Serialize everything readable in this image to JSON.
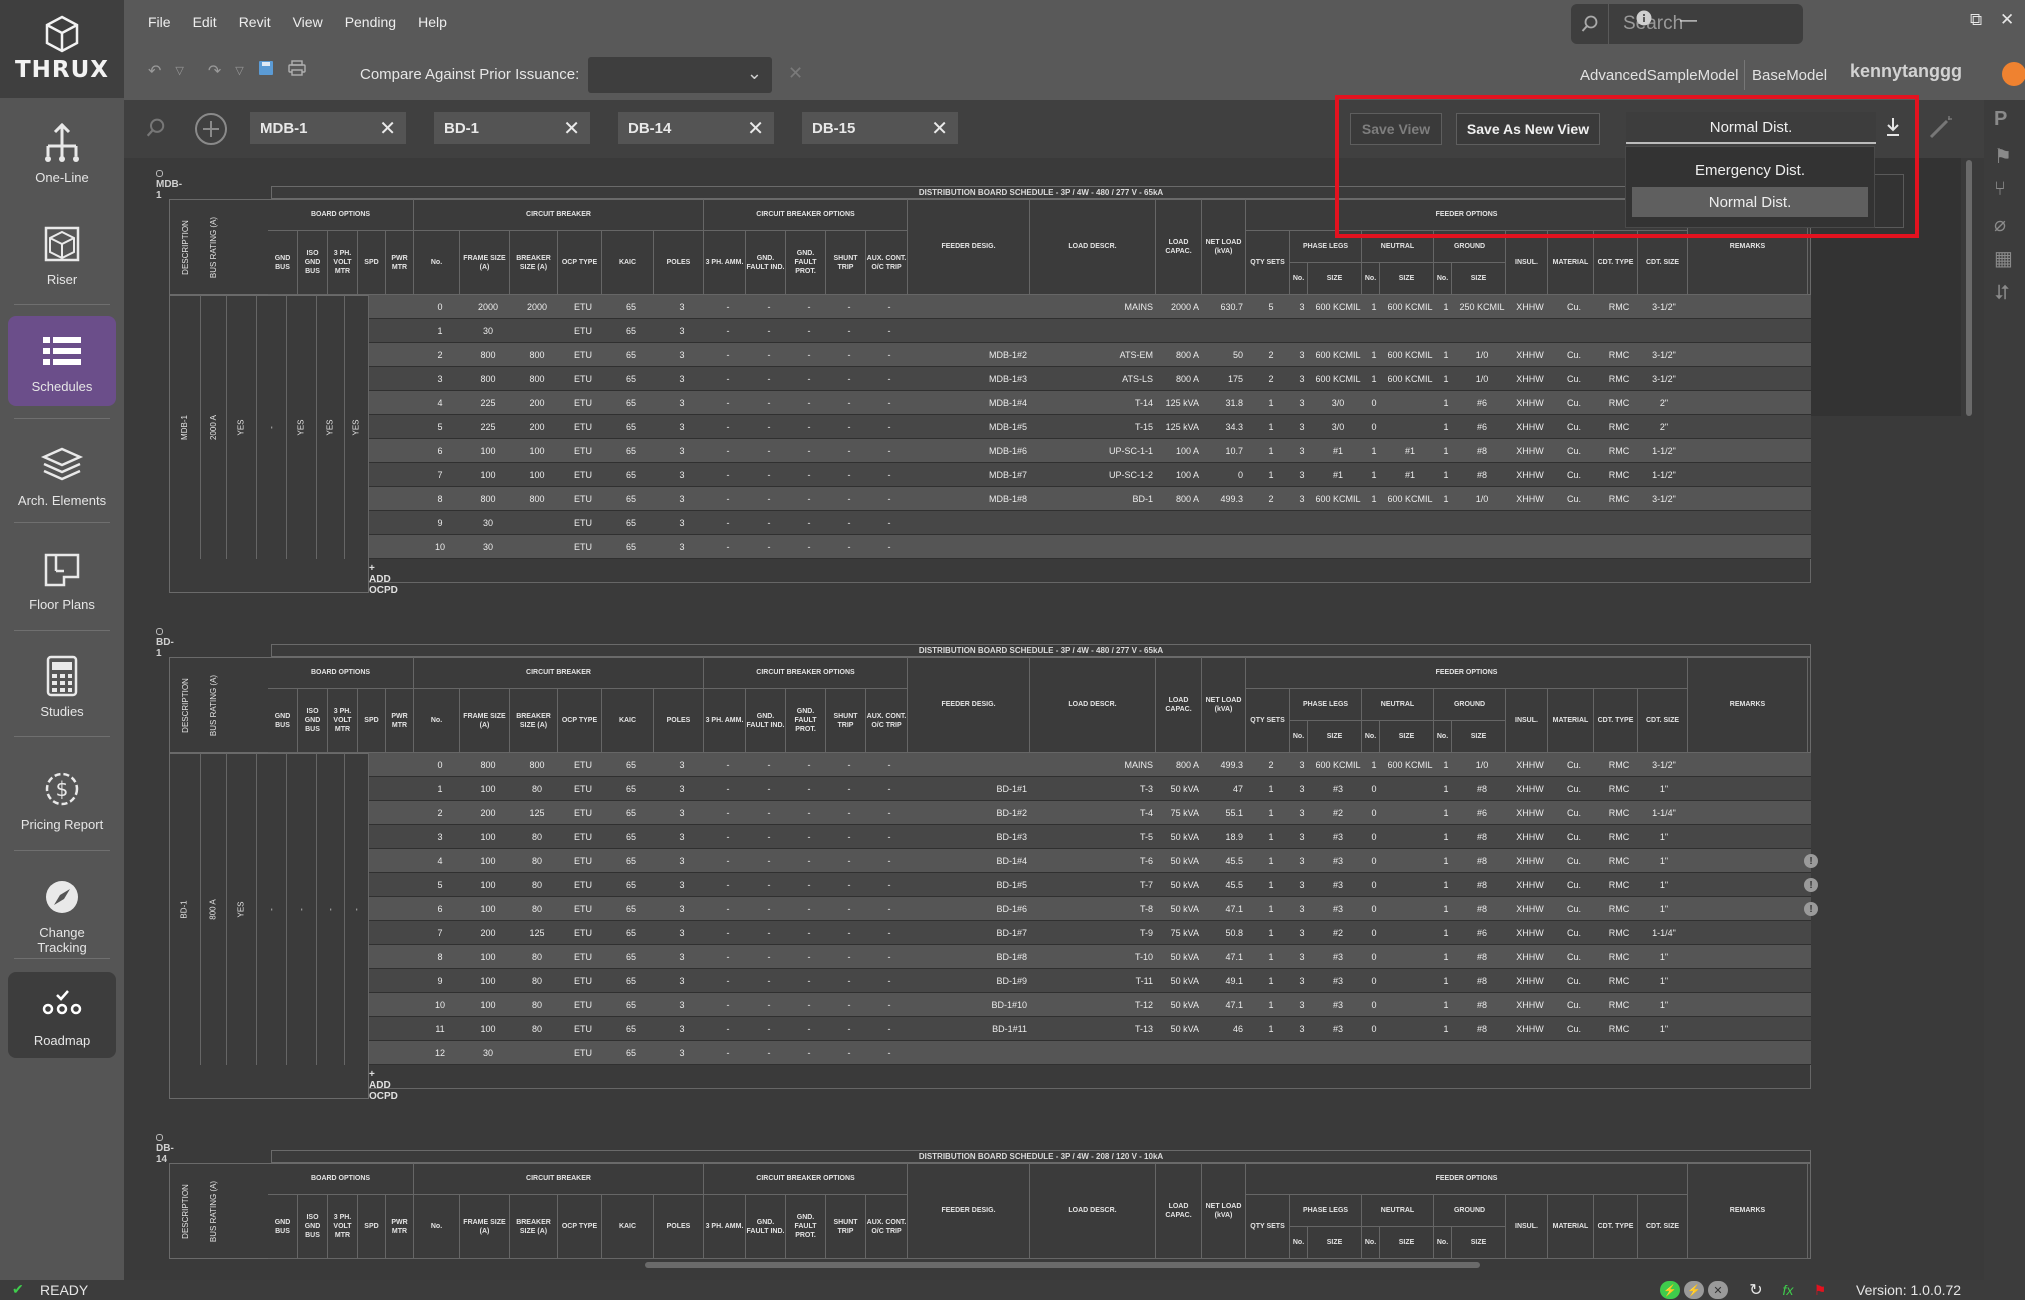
{
  "brand": {
    "name": "THRUX"
  },
  "nav": [
    {
      "label": "One-Line",
      "icon": "one-line-icon"
    },
    {
      "label": "Riser",
      "icon": "riser-cube-icon"
    },
    {
      "label": "Schedules",
      "icon": "schedules-list-icon"
    },
    {
      "label": "Arch. Elements",
      "icon": "layers-icon"
    },
    {
      "label": "Floor Plans",
      "icon": "floor-plan-icon"
    },
    {
      "label": "Studies",
      "icon": "calculator-icon"
    },
    {
      "label": "Pricing Report",
      "icon": "dollar-gear-icon"
    },
    {
      "label": "Change Tracking",
      "icon": "compass-icon"
    },
    {
      "label": "Roadmap",
      "icon": "roadmap-icon"
    }
  ],
  "menu": [
    "File",
    "Edit",
    "Revit",
    "View",
    "Pending",
    "Help"
  ],
  "search": {
    "placeholder": "Search"
  },
  "compare": {
    "label": "Compare Against Prior Issuance:",
    "value": ""
  },
  "models": {
    "a": "AdvancedSampleModel",
    "b": "BaseModel"
  },
  "user": {
    "name": "kennytanggg"
  },
  "tabs": [
    "MDB-1",
    "BD-1",
    "DB-14",
    "DB-15"
  ],
  "view_actions": {
    "save": "Save View",
    "save_as": "Save As New View"
  },
  "view_dropdown": {
    "selected": "Normal Dist.",
    "options": [
      "Emergency Dist.",
      "Normal Dist."
    ]
  },
  "headers": {
    "description": "DESCRIPTION",
    "bus_rating": "BUS RATING (A)",
    "board_options": "BOARD OPTIONS",
    "gnd_bus": "GND BUS",
    "iso_gnd_bus": "ISO GND BUS",
    "volt_mtr": "3 PH. VOLT MTR",
    "spd": "SPD",
    "pwr_mtr": "PWR MTR",
    "circuit_breaker": "CIRCUIT BREAKER",
    "no": "No.",
    "frame": "FRAME SIZE (A)",
    "breaker": "BREAKER SIZE (A)",
    "ocp": "OCP TYPE",
    "kaic": "KAIC",
    "poles": "POLES",
    "cb_options": "CIRCUIT BREAKER OPTIONS",
    "amm": "3 PH. AMM.",
    "gfi": "GND. FAULT IND.",
    "gfp": "GND. FAULT PROT.",
    "shunt": "SHUNT TRIP",
    "aux": "AUX. CONT. O/C TRIP",
    "feeder_desig": "FEEDER DESIG.",
    "load_descr": "LOAD DESCR.",
    "load_capac": "LOAD CAPAC.",
    "net_load": "NET LOAD (kVA)",
    "qty_sets": "QTY SETS",
    "feeder_options": "FEEDER OPTIONS",
    "phase_legs": "PHASE LEGS",
    "neutral": "NEUTRAL",
    "ground": "GROUND",
    "f_no": "No.",
    "f_size": "SIZE",
    "insul": "INSUL.",
    "material": "MATERIAL",
    "cdt_type": "CDT. TYPE",
    "cdt_size": "CDT. SIZE",
    "remarks": "REMARKS",
    "add_ocpd": "ADD OCPD"
  },
  "schedules": [
    {
      "name": "MDB-1",
      "banner": "DISTRIBUTION BOARD SCHEDULE - 3P / 4W - 480 / 277 V - 65kA",
      "description": "MDB-1",
      "bus_rating": "2000 A",
      "gnd_bus": "YES",
      "iso_gnd_bus": "-",
      "volt_mtr": "YES",
      "spd": "YES",
      "pwr_mtr": "YES",
      "rows": [
        [
          "0",
          "2000",
          "2000",
          "ETU",
          "65",
          "3",
          "-",
          "-",
          "-",
          "-",
          "-",
          "",
          "MAINS",
          "2000 A",
          "630.7",
          "5",
          "3",
          "600 KCMIL",
          "1",
          "600 KCMIL",
          "1",
          "250 KCMIL",
          "XHHW",
          "Cu.",
          "RMC",
          "3-1/2\""
        ],
        [
          "1",
          "30",
          "",
          "ETU",
          "65",
          "3",
          "-",
          "-",
          "-",
          "-",
          "-",
          "",
          "",
          "",
          "",
          "",
          "",
          "",
          "",
          "",
          "",
          "",
          "",
          "",
          "",
          ""
        ],
        [
          "2",
          "800",
          "800",
          "ETU",
          "65",
          "3",
          "-",
          "-",
          "-",
          "-",
          "-",
          "MDB-1#2",
          "ATS-EM",
          "800 A",
          "50",
          "2",
          "3",
          "600 KCMIL",
          "1",
          "600 KCMIL",
          "1",
          "1/0",
          "XHHW",
          "Cu.",
          "RMC",
          "3-1/2\""
        ],
        [
          "3",
          "800",
          "800",
          "ETU",
          "65",
          "3",
          "-",
          "-",
          "-",
          "-",
          "-",
          "MDB-1#3",
          "ATS-LS",
          "800 A",
          "175",
          "2",
          "3",
          "600 KCMIL",
          "1",
          "600 KCMIL",
          "1",
          "1/0",
          "XHHW",
          "Cu.",
          "RMC",
          "3-1/2\""
        ],
        [
          "4",
          "225",
          "200",
          "ETU",
          "65",
          "3",
          "-",
          "-",
          "-",
          "-",
          "-",
          "MDB-1#4",
          "T-14",
          "125 kVA",
          "31.8",
          "1",
          "3",
          "3/0",
          "0",
          "",
          "1",
          "#6",
          "XHHW",
          "Cu.",
          "RMC",
          "2\""
        ],
        [
          "5",
          "225",
          "200",
          "ETU",
          "65",
          "3",
          "-",
          "-",
          "-",
          "-",
          "-",
          "MDB-1#5",
          "T-15",
          "125 kVA",
          "34.3",
          "1",
          "3",
          "3/0",
          "0",
          "",
          "1",
          "#6",
          "XHHW",
          "Cu.",
          "RMC",
          "2\""
        ],
        [
          "6",
          "100",
          "100",
          "ETU",
          "65",
          "3",
          "-",
          "-",
          "-",
          "-",
          "-",
          "MDB-1#6",
          "UP-SC-1-1",
          "100 A",
          "10.7",
          "1",
          "3",
          "#1",
          "1",
          "#1",
          "1",
          "#8",
          "XHHW",
          "Cu.",
          "RMC",
          "1-1/2\""
        ],
        [
          "7",
          "100",
          "100",
          "ETU",
          "65",
          "3",
          "-",
          "-",
          "-",
          "-",
          "-",
          "MDB-1#7",
          "UP-SC-1-2",
          "100 A",
          "0",
          "1",
          "3",
          "#1",
          "1",
          "#1",
          "1",
          "#8",
          "XHHW",
          "Cu.",
          "RMC",
          "1-1/2\""
        ],
        [
          "8",
          "800",
          "800",
          "ETU",
          "65",
          "3",
          "-",
          "-",
          "-",
          "-",
          "-",
          "MDB-1#8",
          "BD-1",
          "800 A",
          "499.3",
          "2",
          "3",
          "600 KCMIL",
          "1",
          "600 KCMIL",
          "1",
          "1/0",
          "XHHW",
          "Cu.",
          "RMC",
          "3-1/2\""
        ],
        [
          "9",
          "30",
          "",
          "ETU",
          "65",
          "3",
          "-",
          "-",
          "-",
          "-",
          "-",
          "",
          "",
          "",
          "",
          "",
          "",
          "",
          "",
          "",
          "",
          "",
          "",
          "",
          "",
          ""
        ],
        [
          "10",
          "30",
          "",
          "ETU",
          "65",
          "3",
          "-",
          "-",
          "-",
          "-",
          "-",
          "",
          "",
          "",
          "",
          "",
          "",
          "",
          "",
          "",
          "",
          "",
          "",
          "",
          "",
          ""
        ]
      ]
    },
    {
      "name": "BD-1",
      "banner": "DISTRIBUTION BOARD SCHEDULE - 3P / 4W - 480 / 277 V - 65kA",
      "description": "BD-1",
      "bus_rating": "800 A",
      "gnd_bus": "YES",
      "iso_gnd_bus": "-",
      "volt_mtr": "-",
      "spd": "-",
      "pwr_mtr": "-",
      "rows": [
        [
          "0",
          "800",
          "800",
          "ETU",
          "65",
          "3",
          "-",
          "-",
          "-",
          "-",
          "-",
          "",
          "MAINS",
          "800 A",
          "499.3",
          "2",
          "3",
          "600 KCMIL",
          "1",
          "600 KCMIL",
          "1",
          "1/0",
          "XHHW",
          "Cu.",
          "RMC",
          "3-1/2\""
        ],
        [
          "1",
          "100",
          "80",
          "ETU",
          "65",
          "3",
          "-",
          "-",
          "-",
          "-",
          "-",
          "BD-1#1",
          "T-3",
          "50 kVA",
          "47",
          "1",
          "3",
          "#3",
          "0",
          "",
          "1",
          "#8",
          "XHHW",
          "Cu.",
          "RMC",
          "1\""
        ],
        [
          "2",
          "200",
          "125",
          "ETU",
          "65",
          "3",
          "-",
          "-",
          "-",
          "-",
          "-",
          "BD-1#2",
          "T-4",
          "75 kVA",
          "55.1",
          "1",
          "3",
          "#2",
          "0",
          "",
          "1",
          "#6",
          "XHHW",
          "Cu.",
          "RMC",
          "1-1/4\""
        ],
        [
          "3",
          "100",
          "80",
          "ETU",
          "65",
          "3",
          "-",
          "-",
          "-",
          "-",
          "-",
          "BD-1#3",
          "T-5",
          "50 kVA",
          "18.9",
          "1",
          "3",
          "#3",
          "0",
          "",
          "1",
          "#8",
          "XHHW",
          "Cu.",
          "RMC",
          "1\""
        ],
        [
          "4",
          "100",
          "80",
          "ETU",
          "65",
          "3",
          "-",
          "-",
          "-",
          "-",
          "-",
          "BD-1#4",
          "T-6",
          "50 kVA",
          "45.5",
          "1",
          "3",
          "#3",
          "0",
          "",
          "1",
          "#8",
          "XHHW",
          "Cu.",
          "RMC",
          "1\""
        ],
        [
          "5",
          "100",
          "80",
          "ETU",
          "65",
          "3",
          "-",
          "-",
          "-",
          "-",
          "-",
          "BD-1#5",
          "T-7",
          "50 kVA",
          "45.5",
          "1",
          "3",
          "#3",
          "0",
          "",
          "1",
          "#8",
          "XHHW",
          "Cu.",
          "RMC",
          "1\""
        ],
        [
          "6",
          "100",
          "80",
          "ETU",
          "65",
          "3",
          "-",
          "-",
          "-",
          "-",
          "-",
          "BD-1#6",
          "T-8",
          "50 kVA",
          "47.1",
          "1",
          "3",
          "#3",
          "0",
          "",
          "1",
          "#8",
          "XHHW",
          "Cu.",
          "RMC",
          "1\""
        ],
        [
          "7",
          "200",
          "125",
          "ETU",
          "65",
          "3",
          "-",
          "-",
          "-",
          "-",
          "-",
          "BD-1#7",
          "T-9",
          "75 kVA",
          "50.8",
          "1",
          "3",
          "#2",
          "0",
          "",
          "1",
          "#6",
          "XHHW",
          "Cu.",
          "RMC",
          "1-1/4\""
        ],
        [
          "8",
          "100",
          "80",
          "ETU",
          "65",
          "3",
          "-",
          "-",
          "-",
          "-",
          "-",
          "BD-1#8",
          "T-10",
          "50 kVA",
          "47.1",
          "1",
          "3",
          "#3",
          "0",
          "",
          "1",
          "#8",
          "XHHW",
          "Cu.",
          "RMC",
          "1\""
        ],
        [
          "9",
          "100",
          "80",
          "ETU",
          "65",
          "3",
          "-",
          "-",
          "-",
          "-",
          "-",
          "BD-1#9",
          "T-11",
          "50 kVA",
          "49.1",
          "1",
          "3",
          "#3",
          "0",
          "",
          "1",
          "#8",
          "XHHW",
          "Cu.",
          "RMC",
          "1\""
        ],
        [
          "10",
          "100",
          "80",
          "ETU",
          "65",
          "3",
          "-",
          "-",
          "-",
          "-",
          "-",
          "BD-1#10",
          "T-12",
          "50 kVA",
          "47.1",
          "1",
          "3",
          "#3",
          "0",
          "",
          "1",
          "#8",
          "XHHW",
          "Cu.",
          "RMC",
          "1\""
        ],
        [
          "11",
          "100",
          "80",
          "ETU",
          "65",
          "3",
          "-",
          "-",
          "-",
          "-",
          "-",
          "BD-1#11",
          "T-13",
          "50 kVA",
          "46",
          "1",
          "3",
          "#3",
          "0",
          "",
          "1",
          "#8",
          "XHHW",
          "Cu.",
          "RMC",
          "1\""
        ],
        [
          "12",
          "30",
          "",
          "ETU",
          "65",
          "3",
          "-",
          "-",
          "-",
          "-",
          "-",
          "",
          "",
          "",
          "",
          "",
          "",
          "",
          "",
          "",
          "",
          "",
          "",
          "",
          "",
          ""
        ]
      ],
      "warning_rows": [
        4,
        5,
        6
      ],
      "warning_symbol": "!"
    },
    {
      "name": "DB-14",
      "banner": "DISTRIBUTION BOARD SCHEDULE - 3P / 4W - 208 / 120 V - 10kA",
      "rows": []
    }
  ],
  "status": {
    "text": "READY",
    "version": "Version: 1.0.0.72"
  },
  "colors": {
    "accent": "#6b4e8a",
    "highlight": "#e3121f",
    "ready": "#3fcc4c",
    "user": "#ef8230"
  }
}
